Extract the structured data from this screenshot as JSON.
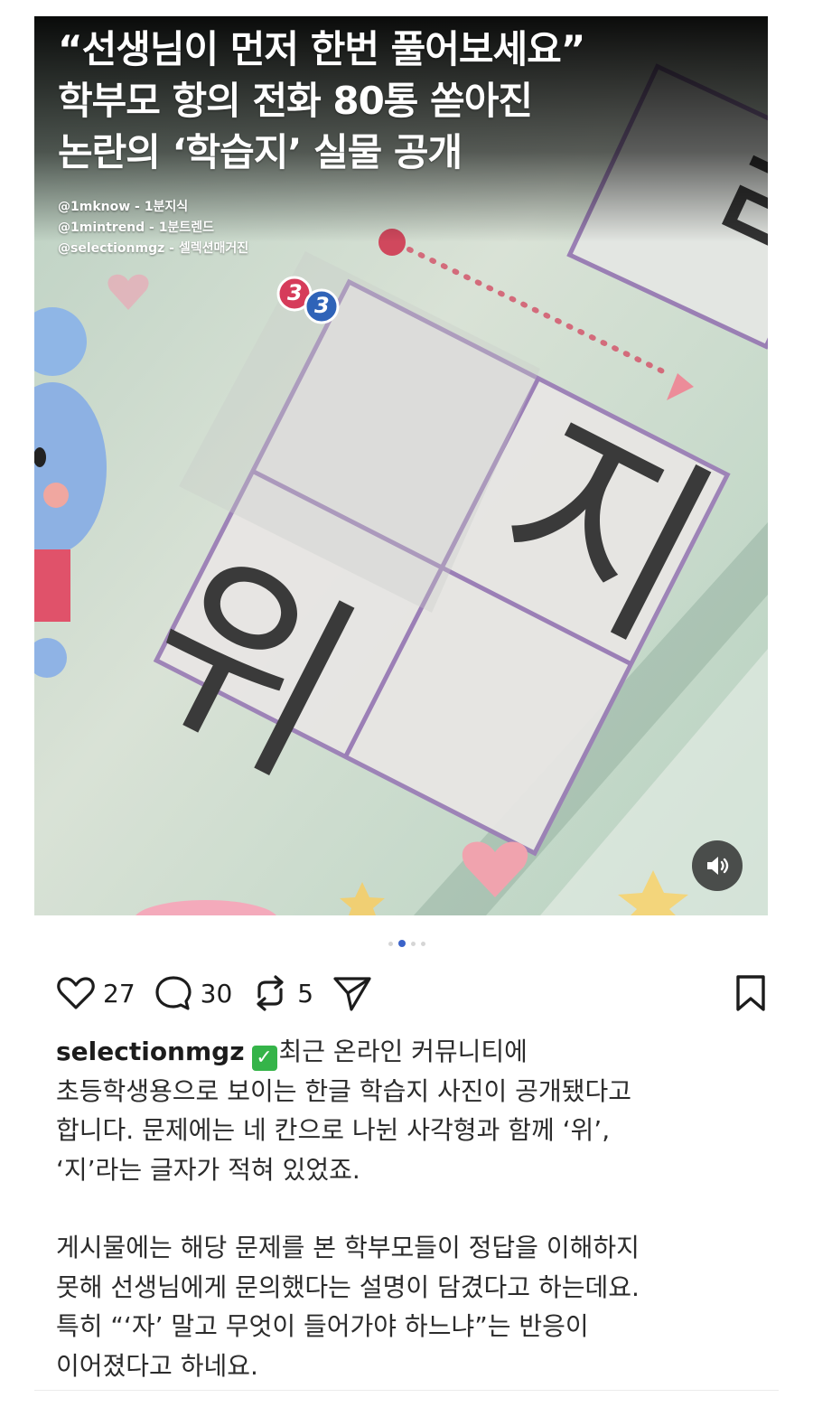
{
  "post_image": {
    "headline_lines": [
      "“선생님이 먼저 한번 풀어보세요”",
      "학부모 항의 전화 80통 쏟아진",
      "논란의 ‘학습지’ 실물 공개"
    ],
    "source_handles": [
      "@1mknow - 1분지식",
      "@1mintrend - 1분트렌드",
      "@selectionmgz - 셀렉션매거진"
    ],
    "worksheet": {
      "badge_numbers": [
        "3",
        "3"
      ],
      "characters": [
        "지",
        "위"
      ]
    },
    "mute_icon": "speaker-icon"
  },
  "carousel": {
    "count": 4,
    "active_index": 1
  },
  "actions": {
    "like_count": "27",
    "comment_count": "30",
    "repost_count": "5",
    "icons": [
      "heart-icon",
      "comment-icon",
      "repost-icon",
      "share-icon",
      "bookmark-icon"
    ]
  },
  "caption": {
    "username": "selectionmgz",
    "badge_glyph": "✓",
    "badge_color": "#35b449",
    "lines": [
      "최근 온라인 커뮤니티에",
      "초등학생용으로 보이는 한글 학습지 사진이 공개됐다고",
      "합니다. 문제에는 네 칸으로 나뉜 사각형과 함께 ‘위’,",
      "‘지’라는 글자가 적혀 있었죠.",
      "게시물에는 해당 문제를 본 학부모들이 정답을 이해하지",
      "못해 선생님에게 문의했다는 설명이 담겼다고 하는데요.",
      "특히 “‘자’ 말고 무엇이 들어가야 하느냐”는 반응이",
      "이어졌다고 하네요."
    ]
  }
}
